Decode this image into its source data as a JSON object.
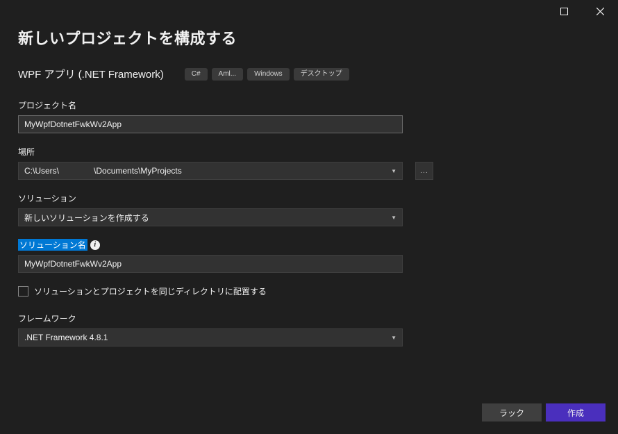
{
  "window": {
    "maximize_title": "Maximize",
    "close_title": "Close"
  },
  "header": {
    "title": "新しいプロジェクトを構成する",
    "subtitle": "WPF アプリ (.NET Framework)",
    "tags": [
      "C#",
      "Aml...",
      "Windows",
      "デスクトップ"
    ]
  },
  "fields": {
    "project_name": {
      "label": "プロジェクト名",
      "value": "MyWpfDotnetFwkWv2App"
    },
    "location": {
      "label": "場所",
      "path_prefix": "C:\\Users\\",
      "path_suffix": "\\Documents\\MyProjects",
      "browse": "..."
    },
    "solution": {
      "label": "ソリューション",
      "value": "新しいソリューションを作成する"
    },
    "solution_name": {
      "label": "ソリューション名",
      "info": "i",
      "value": "MyWpfDotnetFwkWv2App"
    },
    "same_dir": {
      "label": "ソリューションとプロジェクトを同じディレクトリに配置する",
      "checked": false
    },
    "framework": {
      "label": "フレームワーク",
      "value": ".NET Framework 4.8.1"
    }
  },
  "footer": {
    "back": "ラック",
    "create": "作成"
  }
}
